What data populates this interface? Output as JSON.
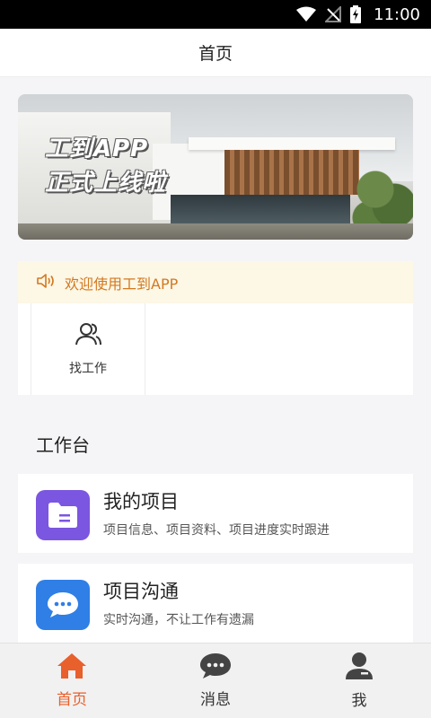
{
  "status_bar": {
    "time": "11:00",
    "icons": [
      "wifi-icon",
      "no-signal-icon",
      "battery-charging-icon"
    ]
  },
  "header": {
    "title": "首页"
  },
  "banner": {
    "line1": "工到APP",
    "line2": "正式上线啦"
  },
  "notice": {
    "icon": "speaker-icon",
    "text": "欢迎使用工到APP"
  },
  "quick_actions": [
    {
      "label": "找工作",
      "icon": "people-icon"
    }
  ],
  "workbench": {
    "title": "工作台",
    "cards": [
      {
        "title": "我的项目",
        "desc": "项目信息、项目资料、项目进度实时跟进",
        "icon": "folder-icon",
        "color": "#7b56e0"
      },
      {
        "title": "项目沟通",
        "desc": "实时沟通，不让工作有遗漏",
        "icon": "chat-icon",
        "color": "#2f7fe6"
      }
    ]
  },
  "tabbar": {
    "active_color": "#e8602c",
    "items": [
      {
        "label": "首页",
        "icon": "home-icon",
        "active": true
      },
      {
        "label": "消息",
        "icon": "message-icon",
        "active": false
      },
      {
        "label": "我",
        "icon": "profile-icon",
        "active": false
      }
    ]
  }
}
